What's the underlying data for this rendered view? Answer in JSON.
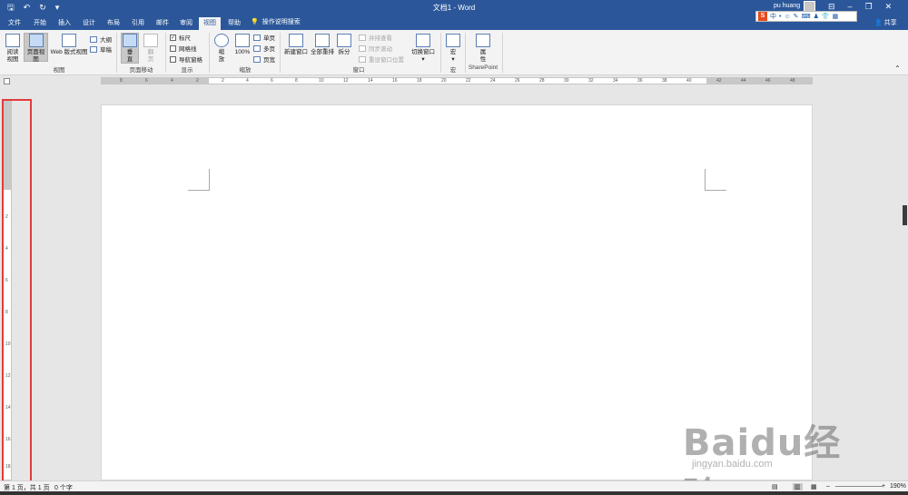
{
  "window": {
    "title": "文档1 - Word",
    "user": "pu huang",
    "share": "共享",
    "qat": [
      "save-icon",
      "undo-icon",
      "redo-icon",
      "customize-icon"
    ]
  },
  "tabs": [
    "文件",
    "开始",
    "插入",
    "设计",
    "布局",
    "引用",
    "邮件",
    "审阅",
    "视图",
    "帮助"
  ],
  "active_tab": "视图",
  "tell_me": "操作说明搜索",
  "ime": {
    "logo": "S",
    "items": [
      "中",
      "•",
      "☺",
      "✎",
      "⌨",
      "♟",
      "👕",
      "▦"
    ]
  },
  "ribbon": {
    "views": {
      "read_mode": [
        "阅读",
        "视图"
      ],
      "print_layout": "页面视图",
      "web_layout": "Web 版式视图",
      "outline": "大纲",
      "draft": "草稿",
      "group": "视图"
    },
    "page_movement": {
      "vertical": [
        "垂",
        "直"
      ],
      "side": [
        "翻",
        "页"
      ],
      "group": "页面移动"
    },
    "show": {
      "ruler": "标尺",
      "gridlines": "网格线",
      "nav_pane": "导航窗格",
      "ruler_checked": true,
      "gridlines_checked": false,
      "nav_checked": false,
      "group": "显示"
    },
    "zoom": {
      "zoom": [
        "缩",
        "放"
      ],
      "hundred": "100%",
      "one_page": "单页",
      "multi_page": "多页",
      "page_width": "页宽",
      "group": "缩放"
    },
    "window": {
      "new_window": "新建窗口",
      "arrange_all": "全部重排",
      "split": "拆分",
      "side_by_side": "并排查看",
      "sync_scroll": "同步滚动",
      "reset_pos": "重设窗口位置",
      "switch": "切换窗口",
      "group": "窗口"
    },
    "macros": {
      "label": "宏",
      "group": "宏"
    },
    "sharepoint": {
      "label": [
        "属",
        "性"
      ],
      "group": "SharePoint"
    }
  },
  "ruler": {
    "left_ticks": [
      "8",
      "6",
      "4",
      "2"
    ],
    "ticks": [
      "2",
      "4",
      "6",
      "8",
      "10",
      "12",
      "14",
      "16",
      "18",
      "20",
      "22",
      "24",
      "26",
      "28",
      "30",
      "32",
      "34",
      "36",
      "38",
      "40",
      "42",
      "44",
      "46",
      "48"
    ],
    "v_ticks": [
      "2",
      "4",
      "6",
      "8",
      "10",
      "12",
      "14",
      "16",
      "18"
    ]
  },
  "status": {
    "page": "第 1 页，共 1 页",
    "words": "0 个字",
    "zoom": "190%"
  },
  "watermark": {
    "brand": "Baidu经验",
    "url": "jingyan.baidu.com"
  }
}
